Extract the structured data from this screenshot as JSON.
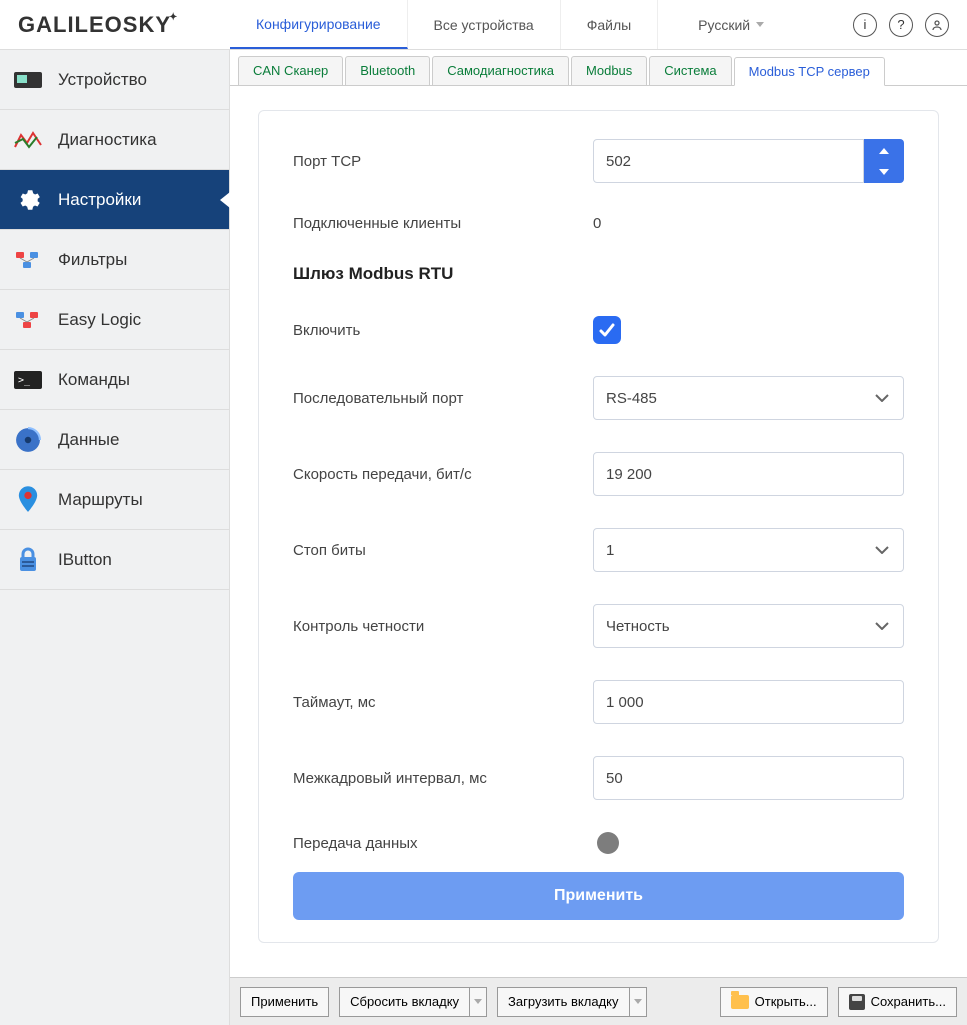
{
  "logo": "GALILEOSKY",
  "toptabs": [
    {
      "label": "Конфигурирование",
      "active": true
    },
    {
      "label": "Все устройства"
    },
    {
      "label": "Файлы"
    }
  ],
  "language": "Русский",
  "sidebar": [
    {
      "label": "Устройство"
    },
    {
      "label": "Диагностика"
    },
    {
      "label": "Настройки",
      "active": true
    },
    {
      "label": "Фильтры"
    },
    {
      "label": "Easy Logic"
    },
    {
      "label": "Команды"
    },
    {
      "label": "Данные"
    },
    {
      "label": "Маршруты"
    },
    {
      "label": "IButton"
    }
  ],
  "subtabs": [
    {
      "label": "CAN Сканер"
    },
    {
      "label": "Bluetooth"
    },
    {
      "label": "Самодиагностика"
    },
    {
      "label": "Modbus"
    },
    {
      "label": "Система"
    },
    {
      "label": "Modbus TCP сервер",
      "active": true
    }
  ],
  "form": {
    "tcp_port_label": "Порт TCP",
    "tcp_port_value": "502",
    "clients_label": "Подключенные клиенты",
    "clients_value": "0",
    "gateway_heading": "Шлюз Modbus RTU",
    "enable_label": "Включить",
    "enable_checked": true,
    "serial_label": "Последовательный порт",
    "serial_value": "RS-485",
    "baud_label": "Скорость передачи, бит/с",
    "baud_value": "19 200",
    "stopbits_label": "Стоп биты",
    "stopbits_value": "1",
    "parity_label": "Контроль четности",
    "parity_value": "Четность",
    "timeout_label": "Таймаут, мс",
    "timeout_value": "1 000",
    "interframe_label": "Межкадровый интервал, мс",
    "interframe_value": "50",
    "transmit_label": "Передача данных",
    "apply_btn": "Применить"
  },
  "bottombar": {
    "apply": "Применить",
    "reset": "Сбросить вкладку",
    "load": "Загрузить вкладку",
    "open": "Открыть...",
    "save": "Сохранить..."
  }
}
